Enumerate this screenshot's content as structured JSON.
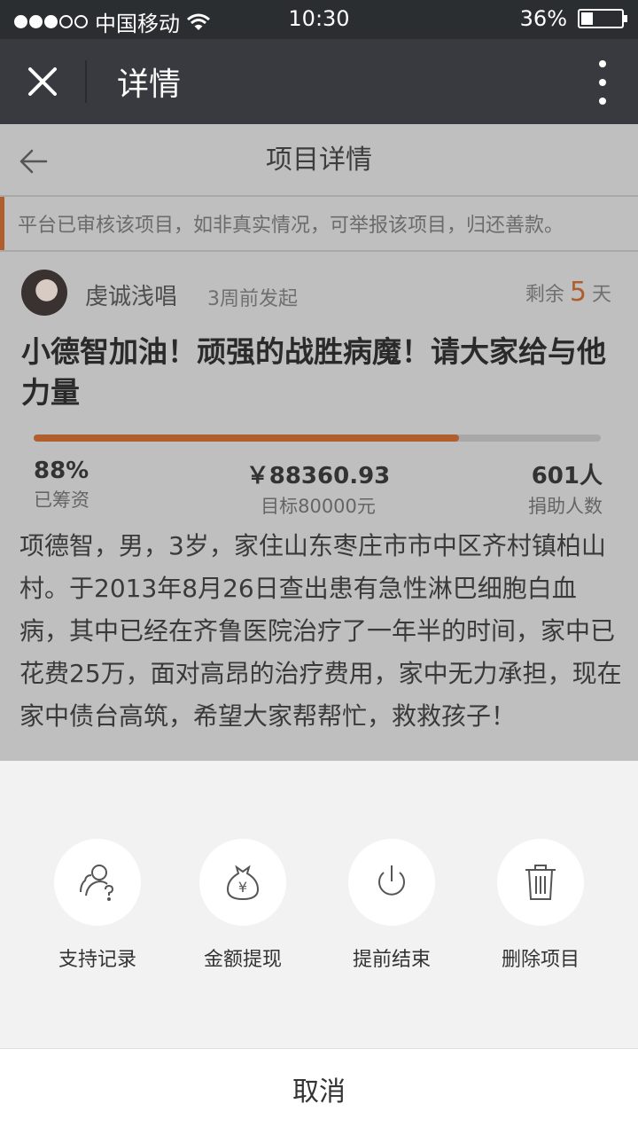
{
  "status_bar": {
    "carrier": "中国移动",
    "time": "10:30",
    "battery": "36%",
    "battery_level": 0.36,
    "signal_bars_filled": 3,
    "signal_bars_total": 5
  },
  "app_bar": {
    "title": "详情"
  },
  "page": {
    "nav_title": "项目详情",
    "notice": "平台已审核该项目，如非真实情况，可举报该项目，归还善款。",
    "author": {
      "name": "虔诚浅唱",
      "posted": "3周前发起",
      "remain_prefix": "剩余",
      "remain_days": "5",
      "remain_suffix": "天"
    },
    "project_title": "小德智加油！顽强的战胜病魔！请大家给与他力量",
    "progress_fraction": 0.75,
    "stats": {
      "percent": "88%",
      "percent_label": "已筹资",
      "amount": "￥88360.93",
      "target_label": "目标80000元",
      "donors": "601人",
      "donors_label": "捐助人数"
    },
    "description": "项德智，男，3岁，家住山东枣庄市市中区齐村镇柏山村。于2013年8月26日查出患有急性淋巴细胞白血病，其中已经在齐鲁医院治疗了一年半的时间，家中已花费25万，面对高昂的治疗费用，家中无力承担，现在家中债台高筑，希望大家帮帮忙，救救孩子！"
  },
  "action_sheet": {
    "actions": [
      {
        "label": "支持记录",
        "icon": "supporters-icon"
      },
      {
        "label": "金额提现",
        "icon": "money-bag-icon"
      },
      {
        "label": "提前结束",
        "icon": "power-icon"
      },
      {
        "label": "删除项目",
        "icon": "trash-icon"
      }
    ],
    "cancel_label": "取消"
  },
  "colors": {
    "accent": "#b05e2e",
    "header_bg": "#393a3f",
    "status_bg": "#2b2e31"
  }
}
